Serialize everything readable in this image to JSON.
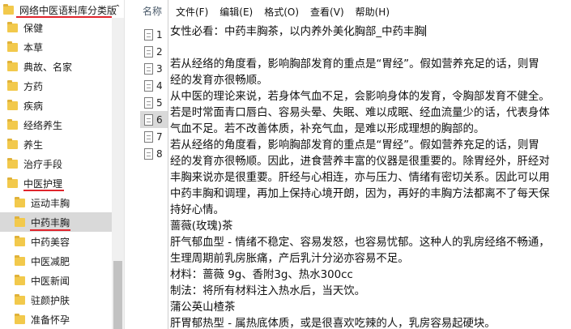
{
  "tree": {
    "root_label": "网络中医语料库分类版",
    "items": [
      {
        "label": "保健"
      },
      {
        "label": "本草"
      },
      {
        "label": "典故、名家"
      },
      {
        "label": "方药"
      },
      {
        "label": "疾病"
      },
      {
        "label": "经络养生"
      },
      {
        "label": "养生"
      },
      {
        "label": "治疗手段"
      },
      {
        "label": "中医护理"
      },
      {
        "label": "运动丰胸"
      },
      {
        "label": "中药丰胸"
      },
      {
        "label": "中药美容"
      },
      {
        "label": "中医减肥"
      },
      {
        "label": "中医新闻"
      },
      {
        "label": "驻颜护肤"
      },
      {
        "label": "准备怀孕"
      }
    ],
    "folder_color": "#f2c94c",
    "highlight_color": "#e0242c"
  },
  "files": {
    "header": "名称",
    "items": [
      "1",
      "2",
      "3",
      "4",
      "5",
      "6",
      "7",
      "8"
    ],
    "selected": "6"
  },
  "notepad": {
    "menu": [
      "文件(F)",
      "编辑(E)",
      "格式(O)",
      "查看(V)",
      "帮助(H)"
    ],
    "lines": [
      "女性必看：中药丰胸茶，以内养外美化胸部_中药丰胸",
      "",
      "若从经络的角度看，影响胸部发育的重点是“胃经”。假如营养充足的话，则胃",
      "经的发育亦很畅顺。",
      "从中医的理论来说，若身体气血不足，会影响身体的发育，令胸部发育不健全。",
      "若是时常面青口唇白、容易头晕、失眠、难以成眠、经血流量少的话，代表身体",
      "气血不足。若不改善体质，补充气血，是难以形成理想的胸部的。",
      "若从经络的角度看，影响胸部发育的重点是“胃经”。假如营养充足的话，则胃",
      "经的发育亦很畅顺。因此，进食营养丰富的仪器是很重要的。除胃经外，肝经对",
      "丰胸来说亦是很重要。肝经与心相连，亦与压力、情绪有密切关系。因此可以用",
      "中药丰胸和调理，再加上保持心境开朗，因为，再好的丰胸方法都离不了每天保",
      "持好心情。",
      "蔷薇(玫瑰)茶",
      "肝气郁血型 - 情绪不稳定、容易发怒，也容易忧郁。这种人的乳房经络不畅通，",
      "生理周期前乳房胀痛，产后乳汁分泌亦容易不足。",
      "材料：蔷薇 9g、香附3g、热水300cc",
      "制法：将所有材料注入热水后，当天饮。",
      "蒲公英山楂茶",
      "肝胃郁热型 - 属热底体质，或是很喜欢吃辣的人，乳房容易起硬块。"
    ]
  }
}
